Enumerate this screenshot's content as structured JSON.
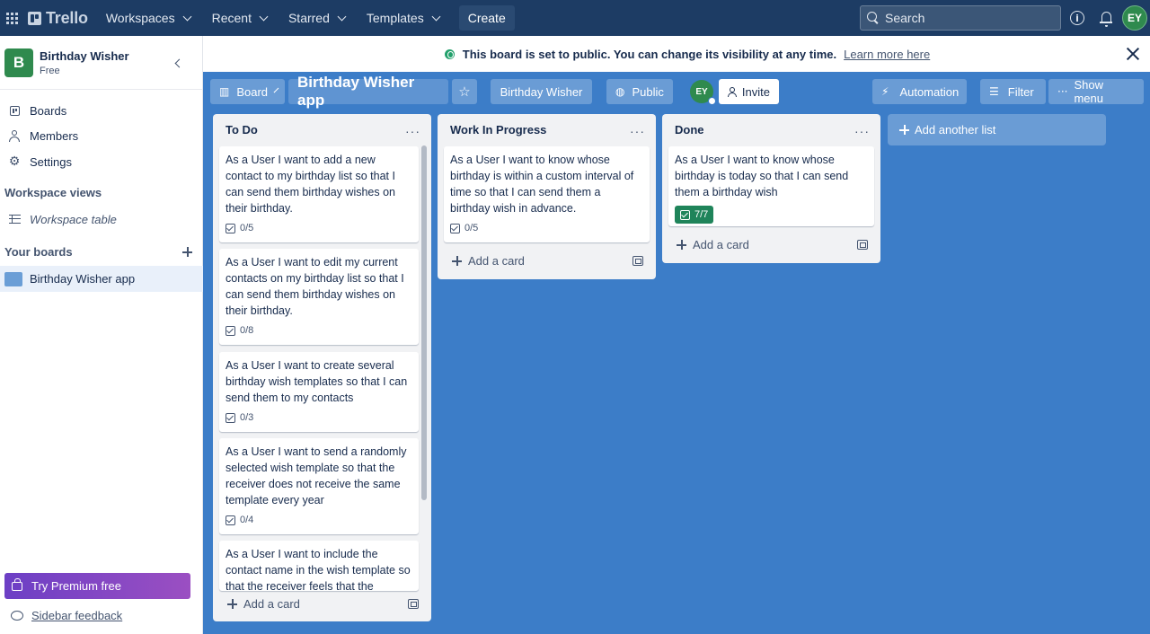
{
  "topnav": {
    "brand": "Trello",
    "menus": [
      "Workspaces",
      "Recent",
      "Starred",
      "Templates"
    ],
    "create_label": "Create",
    "search_placeholder": "Search",
    "avatar_initials": "EY"
  },
  "sidebar": {
    "workspace_initial": "B",
    "workspace_name": "Birthday Wisher",
    "workspace_plan": "Free",
    "items": [
      "Boards",
      "Members",
      "Settings"
    ],
    "views_heading": "Workspace views",
    "workspace_table": "Workspace table",
    "your_boards_heading": "Your boards",
    "boards": [
      "Birthday Wisher app"
    ],
    "premium_label": "Try Premium free",
    "feedback_label": "Sidebar feedback"
  },
  "banner": {
    "message": "This board is set to public. You can change its visibility at any time.",
    "link": "Learn more here"
  },
  "board_header": {
    "view_label": "Board",
    "title": "Birthday Wisher app",
    "workspace_label": "Birthday Wisher",
    "visibility_label": "Public",
    "member_initials": "EY",
    "invite_label": "Invite",
    "automation_label": "Automation",
    "filter_label": "Filter",
    "show_menu_label": "Show menu"
  },
  "lists": [
    {
      "title": "To Do",
      "cards": [
        {
          "text": "As a User I want to add a new contact to my birthday list so that I can send them birthday wishes on their birthday.",
          "checklist": "0/5"
        },
        {
          "text": "As a User I want to edit my current contacts on my birthday list so that I can send them birthday wishes on their birthday.",
          "checklist": "0/8"
        },
        {
          "text": "As a User I want to create several birthday wish templates so that I can send them to my contacts",
          "checklist": "0/3"
        },
        {
          "text": "As a User I want to send a randomly selected wish template so that the receiver does not receive the same template every year",
          "checklist": "0/4"
        },
        {
          "text": "As a User I want to include the contact name in the wish template so that the receiver feels that the",
          "checklist": ""
        }
      ],
      "add_card_label": "Add a card"
    },
    {
      "title": "Work In Progress",
      "cards": [
        {
          "text": "As a User I want to know whose birthday is within a custom interval of time so that I can send them a birthday wish in advance.",
          "checklist": "0/5"
        }
      ],
      "add_card_label": "Add a card"
    },
    {
      "title": "Done",
      "cards": [
        {
          "text": "As a User I want to know whose birthday is today so that I can send them a birthday wish",
          "checklist": "7/7"
        }
      ],
      "add_card_label": "Add a card"
    }
  ],
  "add_list_label": "Add another list",
  "colors": {
    "nav_bg": "#1d3c64",
    "board_bg": "#3c7dc8",
    "workspace_green": "#2f8a4e",
    "checklist_complete": "#1f845a",
    "premium_purple": "#6c3fc5"
  }
}
